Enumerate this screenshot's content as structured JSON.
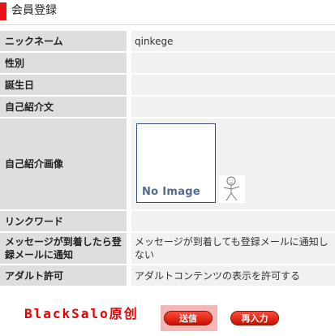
{
  "header": {
    "title": "会員登録"
  },
  "profile": {
    "nickname": {
      "label": "ニックネーム",
      "value": "qinkege"
    },
    "gender": {
      "label": "性別",
      "value": ""
    },
    "birthday": {
      "label": "誕生日",
      "value": ""
    },
    "intro": {
      "label": "自己紹介文",
      "value": ""
    },
    "photo": {
      "label": "自己紹介画像",
      "placeholder_text": "No Image"
    },
    "link_word": {
      "label": "リンクワード",
      "value": ""
    },
    "notify": {
      "label": "メッセージが到着したら登録メールに通知",
      "value": "メッセージが到着しても登録メールに通知しない"
    },
    "adult": {
      "label": "アダルト許可",
      "value": "アダルトコンテンツの表示を許可する"
    }
  },
  "footer": {
    "watermark": "BlackSalo原创",
    "submit_label": "送信",
    "reset_label": "再入力"
  },
  "colors": {
    "accent": "#e8141a",
    "label_bg": "#dedede",
    "value_bg": "#f1f1f1"
  }
}
